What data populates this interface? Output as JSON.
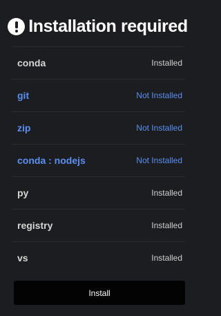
{
  "header": {
    "icon": "exclamation-circle-icon",
    "title": "Installation required"
  },
  "packages": [
    {
      "name": "conda",
      "status": "Installed",
      "installed": true
    },
    {
      "name": "git",
      "status": "Not Installed",
      "installed": false
    },
    {
      "name": "zip",
      "status": "Not Installed",
      "installed": false
    },
    {
      "name": "conda : nodejs",
      "status": "Not Installed",
      "installed": false
    },
    {
      "name": "py",
      "status": "Installed",
      "installed": true
    },
    {
      "name": "registry",
      "status": "Installed",
      "installed": true
    },
    {
      "name": "vs",
      "status": "Installed",
      "installed": true
    }
  ],
  "actions": {
    "install_label": "Install"
  },
  "colors": {
    "background": "#1c1d20",
    "installed_text": "#d6d6d6",
    "not_installed_text": "#5b8ff0",
    "button_bg": "#030303"
  }
}
